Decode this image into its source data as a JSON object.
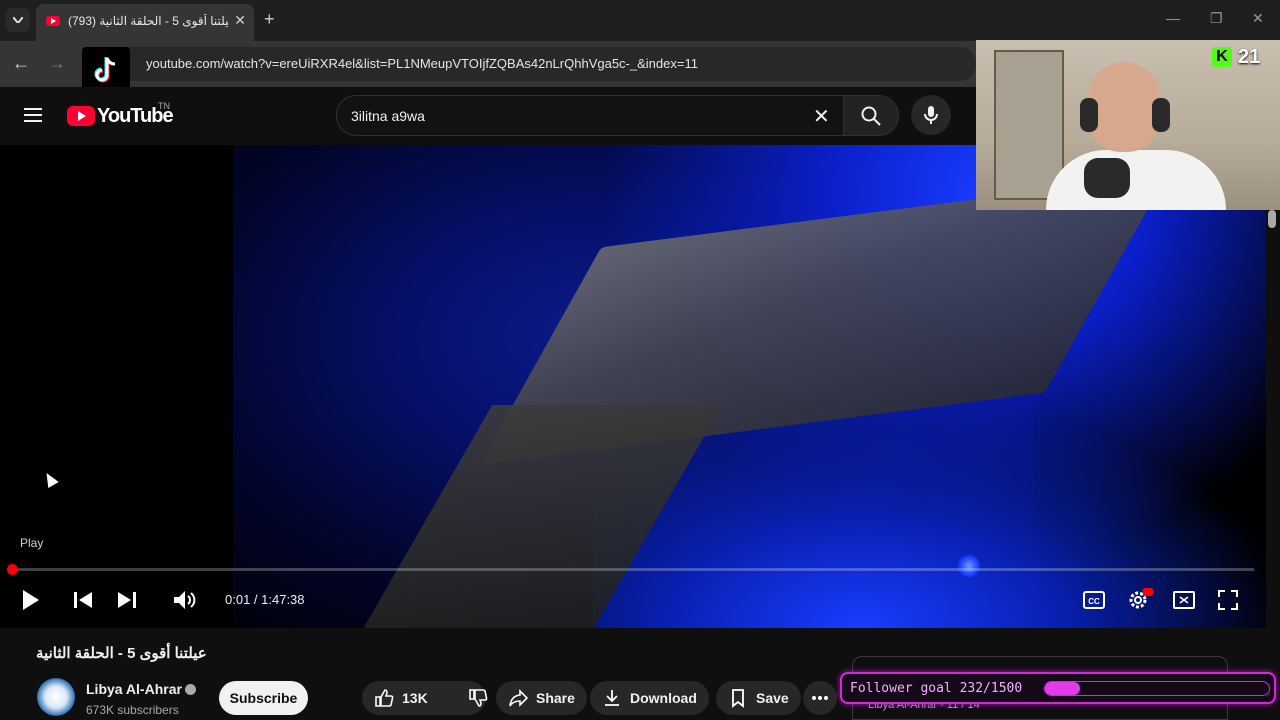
{
  "browser": {
    "tab_title": "(793) عيلتنا أقوى 5 - الحلقة الثانية",
    "url": "youtube.com/watch?v=ereUiRXR4el&list=PL1NMeupVTOIjfZQBAs42nLrQhhVga5c-_&index=11"
  },
  "youtube": {
    "logo_text": "YouTube",
    "country_code": "TN",
    "search_value": "3ilitna a9wa"
  },
  "player": {
    "play_tooltip": "Play",
    "time": "0:01 / 1:47:38",
    "progress_fraction": 0.0001
  },
  "webcam_overlay": {
    "kick_count": "21"
  },
  "video": {
    "title": "عيلتنا أقوى 5 - الحلقة الثانية",
    "channel_name": "Libya Al-Ahrar",
    "subscribers": "673K subscribers",
    "subscribe_label": "Subscribe",
    "likes": "13K",
    "share_label": "Share",
    "download_label": "Download",
    "save_label": "Save"
  },
  "playlist": {
    "subtitle": "Libya Al-Ahrar - 11 / 14"
  },
  "follower_goal": {
    "text": "Follower goal 232/1500",
    "fraction": 0.155
  },
  "colors": {
    "yt_red": "#ff0033",
    "goal_accent": "#e23be9",
    "kick_green": "#53fc18"
  }
}
